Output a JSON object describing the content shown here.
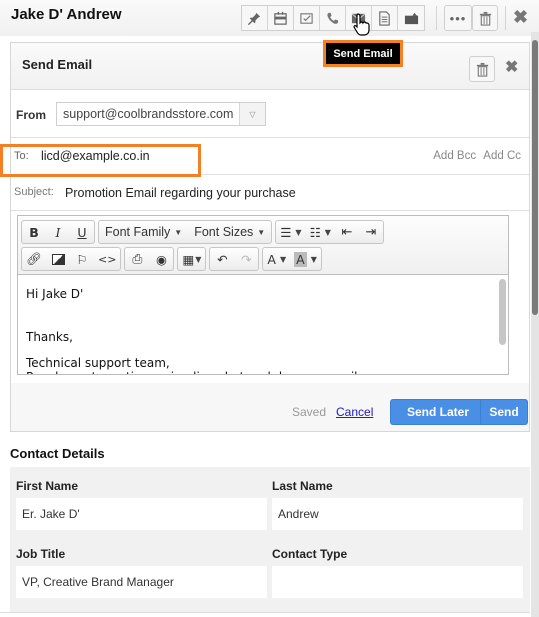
{
  "header": {
    "contact_name": "Jake D' Andrew",
    "toolbar_icons": [
      "pin-icon",
      "calendar-icon",
      "task-check-icon",
      "phone-icon",
      "email-icon",
      "note-icon",
      "folder-icon"
    ],
    "more_icon": "more-dots-icon",
    "delete_icon": "trash-icon",
    "close_icon": "close-icon"
  },
  "tooltip": {
    "text": "Send Email",
    "border_color": "#f47f24"
  },
  "panel": {
    "title": "Send Email",
    "from": {
      "label": "From",
      "value": "support@coolbrandsstore.com"
    },
    "to": {
      "label": "To:",
      "value": "licd@example.co.in",
      "add_bcc": "Add Bcc",
      "add_cc": "Add Cc"
    },
    "subject": {
      "label": "Subject:",
      "value": "Promotion Email regarding your purchase"
    },
    "editor_toolbar": {
      "bold": "B",
      "italic": "I",
      "underline": "U",
      "font_family": "Font Family",
      "font_sizes": "Font Sizes",
      "text_color": "A",
      "bg_color": "A"
    },
    "body_lines": [
      "Hi Jake D'",
      "",
      "Thanks,",
      "Technical support team,",
      "Reach us at any time using live chat and drop an email"
    ],
    "footer": {
      "saved": "Saved",
      "cancel": "Cancel",
      "send_later": "Send Later",
      "send": "Send"
    }
  },
  "contact_details": {
    "title": "Contact Details",
    "fields": [
      {
        "label": "First Name",
        "value": "Er. Jake D'"
      },
      {
        "label": "Last Name",
        "value": "Andrew"
      },
      {
        "label": "Job Title",
        "value": "VP, Creative Brand Manager"
      },
      {
        "label": "Contact Type",
        "value": ""
      }
    ]
  },
  "colors": {
    "accent_blue": "#4a8fe6",
    "highlight_orange": "#f47f24"
  }
}
